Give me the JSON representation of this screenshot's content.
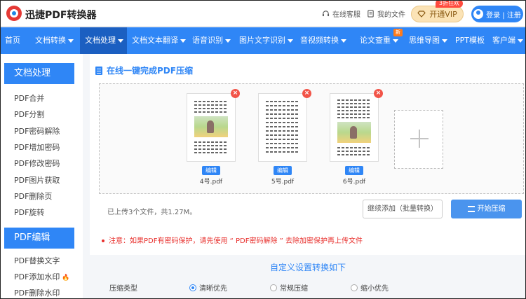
{
  "header": {
    "brand": "迅捷PDF转换器",
    "service_label": "在线客服",
    "myfiles_label": "我的文件",
    "vip_label": "开通VIP",
    "vip_tag": "3折狂欢",
    "login_label": "登录 | 注册"
  },
  "nav": {
    "items": [
      {
        "label": "首页",
        "caret": false
      },
      {
        "label": "文档转换",
        "caret": true
      },
      {
        "label": "文档处理",
        "caret": true,
        "active": true
      },
      {
        "label": "文档文本翻译",
        "caret": true
      },
      {
        "label": "语音识别",
        "caret": true
      },
      {
        "label": "图片文字识别",
        "caret": true
      },
      {
        "label": "音视频转换",
        "caret": true
      },
      {
        "label": "论文查重",
        "caret": true,
        "badge": "新"
      },
      {
        "label": "思维导图",
        "caret": true
      },
      {
        "label": "PPT模板",
        "caret": false
      },
      {
        "label": "客户端",
        "caret": true
      }
    ]
  },
  "sidebar": {
    "section1_title": "文档处理",
    "section1_items": [
      "PDF合并",
      "PDF分割",
      "PDF密码解除",
      "PDF增加密码",
      "PDF修改密码",
      "PDF图片获取",
      "PDF删除页",
      "PDF旋转"
    ],
    "section2_title": "PDF编辑",
    "section2_items": [
      "PDF替换文字",
      "PDF添加水印",
      "PDF删除水印"
    ]
  },
  "main": {
    "title": "在线一键完成PDF压缩",
    "files": [
      {
        "name": "4号.pdf",
        "edit_label": "编辑"
      },
      {
        "name": "5号.pdf",
        "edit_label": "编辑"
      },
      {
        "name": "6号.pdf",
        "edit_label": "编辑"
      }
    ],
    "status_text": "已上传3个文件，共1.27M。",
    "continue_label": "继续添加（批量转换）",
    "start_label": "开始压缩",
    "notice": "注意：如果PDF有密码保护，请先使用 “ PDF密码解除 ” 去除加密保护再上传文件",
    "settings_title": "自定义设置转换如下",
    "compress_label": "压缩类型",
    "compress_options": [
      {
        "label": "清晰优先",
        "selected": true
      },
      {
        "label": "常规压缩",
        "selected": false
      },
      {
        "label": "缩小优先",
        "selected": false
      }
    ]
  },
  "colors": {
    "primary": "#2f86f6",
    "nav_active": "#1b5fc1",
    "danger": "#e8302d"
  }
}
